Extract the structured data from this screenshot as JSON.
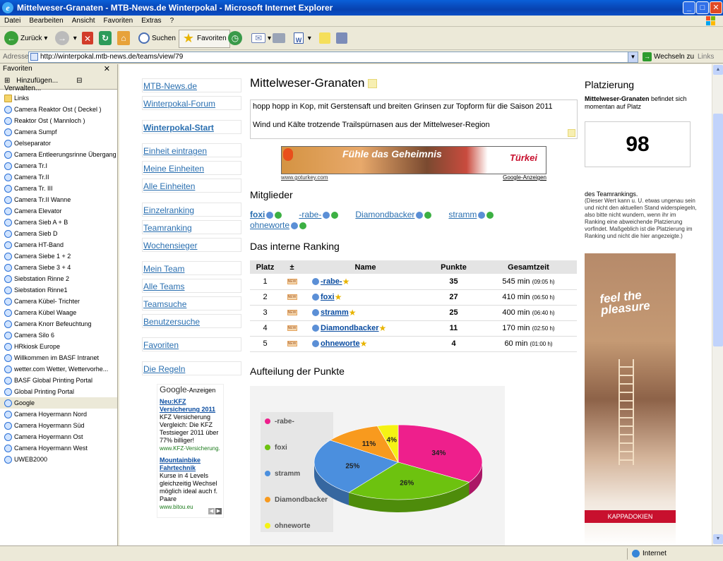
{
  "window": {
    "title": "Mittelweser-Granaten - MTB-News.de Winterpokal - Microsoft Internet Explorer",
    "min": "_",
    "max": "□",
    "close": "✕"
  },
  "menu": [
    "Datei",
    "Bearbeiten",
    "Ansicht",
    "Favoriten",
    "Extras",
    "?"
  ],
  "toolbar": {
    "back": "Zurück",
    "search": "Suchen",
    "favorites": "Favoriten"
  },
  "address": {
    "label": "Adresse",
    "url": "http://winterpokal.mtb-news.de/teams/view/79",
    "go": "Wechseln zu",
    "links": "Links"
  },
  "favorites": {
    "title": "Favoriten",
    "add": "Hinzufügen...",
    "manage": "Verwalten...",
    "items": [
      "Links",
      "Camera Reaktor Ost ( Deckel )",
      "Reaktor Ost ( Mannloch )",
      "Camera Sumpf",
      "Oelseparator",
      "Camera Entleerungsrinne Übergang",
      "Camera Tr.I",
      "Camera Tr.II",
      "Camera Tr. III",
      "Camera Tr.II Wanne",
      "Camera Elevator",
      "Camera Sieb A + B",
      "Camera Sieb D",
      "Camera HT-Band",
      "Camera Siebe 1 + 2",
      "Camera Siebe 3 + 4",
      "Siebstation Rinne 2",
      "Siebstation Rinne1",
      "Camera Kübel- Trichter",
      "Camera Kübel Waage",
      "Camera Knorr Befeuchtung",
      "Camera Silo 6",
      "HRkiosk Europe",
      "Willkommen im BASF Intranet",
      "wetter.com Wetter, Wettervorhe...",
      "BASF Global Printing Portal",
      "Global Printing Portal",
      "Google",
      "Camera Hoyermann Nord",
      "Camera Hoyermann Süd",
      "Camera Hoyermann Ost",
      "Camera Hoyermann West",
      "UWEB2000"
    ]
  },
  "nav": {
    "mtb": "MTB-News.de",
    "forum": "Winterpokal-Forum",
    "start": "Winterpokal-Start",
    "add_unit": "Einheit eintragen",
    "my_units": "Meine Einheiten",
    "all_units": "Alle Einheiten",
    "single_rank": "Einzelranking",
    "team_rank": "Teamranking",
    "weekly": "Wochensieger",
    "my_team": "Mein Team",
    "all_teams": "Alle Teams",
    "team_search": "Teamsuche",
    "user_search": "Benutzersuche",
    "favs": "Favoriten",
    "rules": "Die Regeln"
  },
  "gads": {
    "label": "Google",
    "suffix": "-Anzeigen",
    "ad1_title": "Neu:KFZ Versicherung 2011",
    "ad1_text": "KFZ Versicherung Vergleich: Die KFZ Testsieger 2011 über 77% billiger!",
    "ad1_url": "www.KFZ-Versicherung.",
    "ad2_title": "Mountainbike Fahrtechnik",
    "ad2_text": "Kurse in 4 Levels gleichzeitig Wechsel möglich ideal auch f. Paare",
    "ad2_url": "www.bitou.eu"
  },
  "team": {
    "name": "Mittelweser-Granaten",
    "desc1": "hopp hopp in Kop, mit Gerstensaft und breiten Grinsen zur Topform für die Saison 2011",
    "desc2": "Wind und Kälte trotzende Trailspürnasen aus der Mittelweser-Region"
  },
  "banner": {
    "text": "Fühle das Geheimnis",
    "brand": "Türkei",
    "left_link": "www.goturkey.com",
    "right_link": "Google-Anzeigen"
  },
  "members": {
    "title": "Mitglieder",
    "list": [
      "foxi",
      "-rabe-",
      "Diamondbacker",
      "stramm",
      "ohneworte"
    ]
  },
  "ranking": {
    "title": "Das interne Ranking",
    "headers": [
      "Platz",
      "±",
      "Name",
      "Punkte",
      "Gesamtzeit"
    ],
    "rows": [
      {
        "platz": "1",
        "name": "-rabe-",
        "punkte": "35",
        "zeit": "545 min",
        "zeit_h": "(09:05 h)"
      },
      {
        "platz": "2",
        "name": "foxi",
        "punkte": "27",
        "zeit": "410 min",
        "zeit_h": "(06:50 h)"
      },
      {
        "platz": "3",
        "name": "stramm",
        "punkte": "25",
        "zeit": "400 min",
        "zeit_h": "(06:40 h)"
      },
      {
        "platz": "4",
        "name": "Diamondbacker",
        "punkte": "11",
        "zeit": "170 min",
        "zeit_h": "(02:50 h)"
      },
      {
        "platz": "5",
        "name": "ohneworte",
        "punkte": "4",
        "zeit": "60 min",
        "zeit_h": "(01:00 h)"
      }
    ]
  },
  "chart_title": "Aufteilung der Punkte",
  "chart_data": {
    "type": "pie",
    "title": "Aufteilung der Punkte",
    "categories": [
      "-rabe-",
      "foxi",
      "stramm",
      "Diamondbacker",
      "ohneworte"
    ],
    "values": [
      34,
      26,
      25,
      11,
      4
    ],
    "labels": [
      "34%",
      "26%",
      "25%",
      "11%",
      "4%"
    ],
    "colors": [
      "#ee1f8c",
      "#6dc20f",
      "#4b8fde",
      "#f89a1e",
      "#f5f214"
    ],
    "legend": "left"
  },
  "placement": {
    "title": "Platzierung",
    "team": "Mittelweser-Granaten",
    "text": " befindet sich momentan auf Platz",
    "rank": "98",
    "after": "des Teamrankings.",
    "note": "(Dieser Wert kann u. U. etwas ungenau sein und nicht den aktuellen Stand widerspiegeln, also bitte nicht wundern, wenn ihr im Ranking eine abweichende Platzierung vorfindet. Maßgeblich ist die Platzierung im Ranking und nicht die hier angezeigte.)"
  },
  "side_ad": {
    "text": "feel the pleasure",
    "footer": "KAPPADOKIEN"
  },
  "status": {
    "zone": "Internet"
  }
}
